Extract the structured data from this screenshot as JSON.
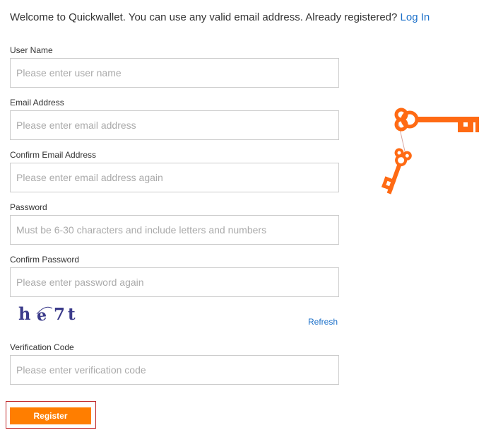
{
  "welcome": {
    "text": "Welcome to Quickwallet. You can use any valid email address. Already registered?",
    "login_link": "Log In"
  },
  "form": {
    "fields": [
      {
        "label": "User Name",
        "placeholder": "Please enter user name",
        "value": ""
      },
      {
        "label": "Email Address",
        "placeholder": "Please enter email address",
        "value": ""
      },
      {
        "label": "Confirm Email Address",
        "placeholder": "Please enter email address again",
        "value": ""
      },
      {
        "label": "Password",
        "placeholder": "Must be 6-30 characters and include letters and numbers",
        "value": ""
      },
      {
        "label": "Confirm Password",
        "placeholder": "Please enter password again",
        "value": ""
      }
    ],
    "captcha": {
      "chars": [
        "h",
        "e",
        "7",
        "t"
      ],
      "color": "#3a3a8a",
      "refresh_label": "Refresh"
    },
    "verification": {
      "label": "Verification Code",
      "placeholder": "Please enter verification code",
      "value": ""
    },
    "register_label": "Register"
  },
  "colors": {
    "accent": "#ff7e00",
    "link": "#1a6fc9",
    "highlight_border": "#c0282a",
    "keys": "#ff6a13"
  },
  "illustration": {
    "icon": "keys-icon"
  }
}
